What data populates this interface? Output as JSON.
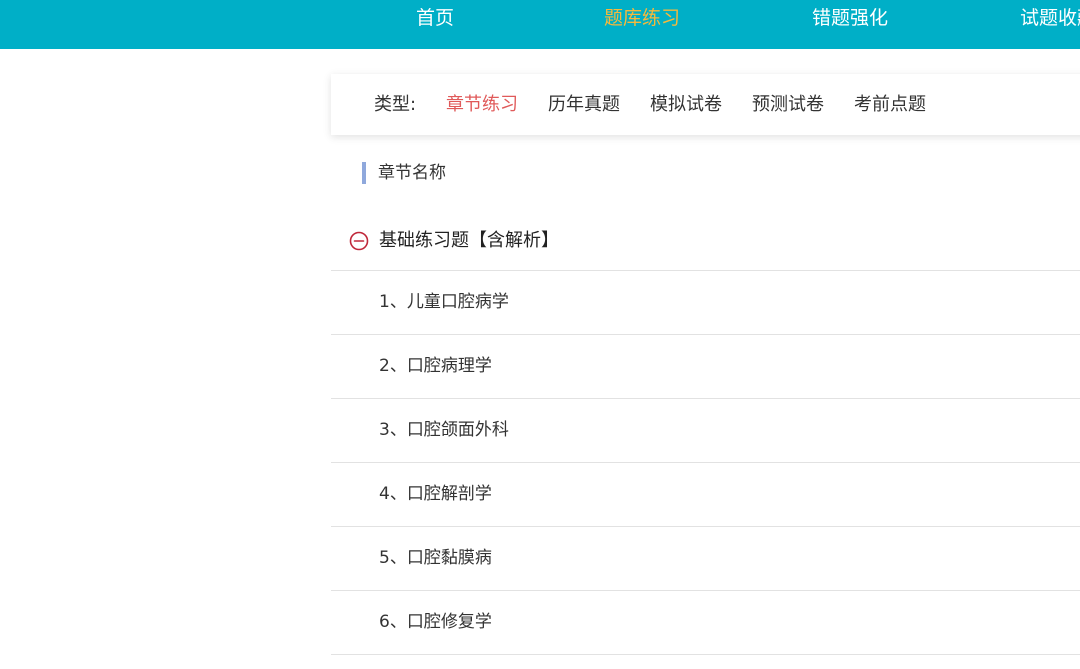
{
  "nav": {
    "items": [
      {
        "label": "首页"
      },
      {
        "label": "题库练习"
      },
      {
        "label": "错题强化"
      },
      {
        "label": "试题收藏"
      }
    ],
    "active_color": "#f6b93b",
    "background": "#00afc7"
  },
  "type_filter": {
    "label": "类型:",
    "options": [
      {
        "label": "章节练习"
      },
      {
        "label": "历年真题"
      },
      {
        "label": "模拟试卷"
      },
      {
        "label": "预测试卷"
      },
      {
        "label": "考前点题"
      }
    ],
    "active_color": "#e05a5a"
  },
  "section": {
    "title": "章节名称"
  },
  "chapter": {
    "title": "基础练习题【含解析】",
    "icon": "minus-circle-icon",
    "items": [
      {
        "label": "1、儿童口腔病学"
      },
      {
        "label": "2、口腔病理学"
      },
      {
        "label": "3、口腔颌面外科"
      },
      {
        "label": "4、口腔解剖学"
      },
      {
        "label": "5、口腔黏膜病"
      },
      {
        "label": "6、口腔修复学"
      }
    ]
  }
}
